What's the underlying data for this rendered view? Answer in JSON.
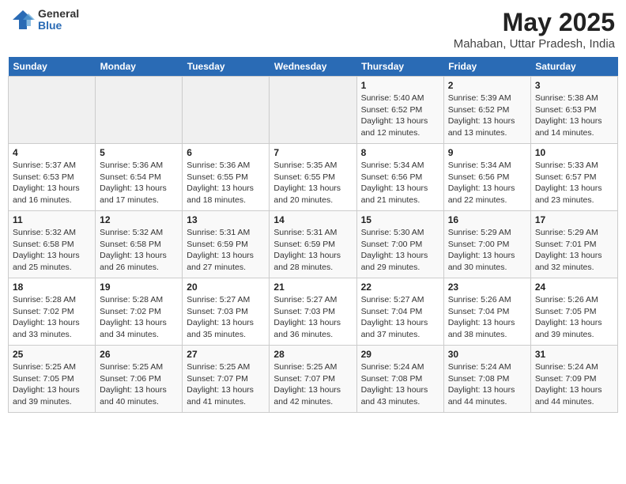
{
  "logo": {
    "general": "General",
    "blue": "Blue"
  },
  "title": "May 2025",
  "subtitle": "Mahaban, Uttar Pradesh, India",
  "days": [
    "Sunday",
    "Monday",
    "Tuesday",
    "Wednesday",
    "Thursday",
    "Friday",
    "Saturday"
  ],
  "weeks": [
    [
      {
        "date": "",
        "info": ""
      },
      {
        "date": "",
        "info": ""
      },
      {
        "date": "",
        "info": ""
      },
      {
        "date": "",
        "info": ""
      },
      {
        "date": "1",
        "info": "Sunrise: 5:40 AM\nSunset: 6:52 PM\nDaylight: 13 hours and 12 minutes."
      },
      {
        "date": "2",
        "info": "Sunrise: 5:39 AM\nSunset: 6:52 PM\nDaylight: 13 hours and 13 minutes."
      },
      {
        "date": "3",
        "info": "Sunrise: 5:38 AM\nSunset: 6:53 PM\nDaylight: 13 hours and 14 minutes."
      }
    ],
    [
      {
        "date": "4",
        "info": "Sunrise: 5:37 AM\nSunset: 6:53 PM\nDaylight: 13 hours and 16 minutes."
      },
      {
        "date": "5",
        "info": "Sunrise: 5:36 AM\nSunset: 6:54 PM\nDaylight: 13 hours and 17 minutes."
      },
      {
        "date": "6",
        "info": "Sunrise: 5:36 AM\nSunset: 6:55 PM\nDaylight: 13 hours and 18 minutes."
      },
      {
        "date": "7",
        "info": "Sunrise: 5:35 AM\nSunset: 6:55 PM\nDaylight: 13 hours and 20 minutes."
      },
      {
        "date": "8",
        "info": "Sunrise: 5:34 AM\nSunset: 6:56 PM\nDaylight: 13 hours and 21 minutes."
      },
      {
        "date": "9",
        "info": "Sunrise: 5:34 AM\nSunset: 6:56 PM\nDaylight: 13 hours and 22 minutes."
      },
      {
        "date": "10",
        "info": "Sunrise: 5:33 AM\nSunset: 6:57 PM\nDaylight: 13 hours and 23 minutes."
      }
    ],
    [
      {
        "date": "11",
        "info": "Sunrise: 5:32 AM\nSunset: 6:58 PM\nDaylight: 13 hours and 25 minutes."
      },
      {
        "date": "12",
        "info": "Sunrise: 5:32 AM\nSunset: 6:58 PM\nDaylight: 13 hours and 26 minutes."
      },
      {
        "date": "13",
        "info": "Sunrise: 5:31 AM\nSunset: 6:59 PM\nDaylight: 13 hours and 27 minutes."
      },
      {
        "date": "14",
        "info": "Sunrise: 5:31 AM\nSunset: 6:59 PM\nDaylight: 13 hours and 28 minutes."
      },
      {
        "date": "15",
        "info": "Sunrise: 5:30 AM\nSunset: 7:00 PM\nDaylight: 13 hours and 29 minutes."
      },
      {
        "date": "16",
        "info": "Sunrise: 5:29 AM\nSunset: 7:00 PM\nDaylight: 13 hours and 30 minutes."
      },
      {
        "date": "17",
        "info": "Sunrise: 5:29 AM\nSunset: 7:01 PM\nDaylight: 13 hours and 32 minutes."
      }
    ],
    [
      {
        "date": "18",
        "info": "Sunrise: 5:28 AM\nSunset: 7:02 PM\nDaylight: 13 hours and 33 minutes."
      },
      {
        "date": "19",
        "info": "Sunrise: 5:28 AM\nSunset: 7:02 PM\nDaylight: 13 hours and 34 minutes."
      },
      {
        "date": "20",
        "info": "Sunrise: 5:27 AM\nSunset: 7:03 PM\nDaylight: 13 hours and 35 minutes."
      },
      {
        "date": "21",
        "info": "Sunrise: 5:27 AM\nSunset: 7:03 PM\nDaylight: 13 hours and 36 minutes."
      },
      {
        "date": "22",
        "info": "Sunrise: 5:27 AM\nSunset: 7:04 PM\nDaylight: 13 hours and 37 minutes."
      },
      {
        "date": "23",
        "info": "Sunrise: 5:26 AM\nSunset: 7:04 PM\nDaylight: 13 hours and 38 minutes."
      },
      {
        "date": "24",
        "info": "Sunrise: 5:26 AM\nSunset: 7:05 PM\nDaylight: 13 hours and 39 minutes."
      }
    ],
    [
      {
        "date": "25",
        "info": "Sunrise: 5:25 AM\nSunset: 7:05 PM\nDaylight: 13 hours and 39 minutes."
      },
      {
        "date": "26",
        "info": "Sunrise: 5:25 AM\nSunset: 7:06 PM\nDaylight: 13 hours and 40 minutes."
      },
      {
        "date": "27",
        "info": "Sunrise: 5:25 AM\nSunset: 7:07 PM\nDaylight: 13 hours and 41 minutes."
      },
      {
        "date": "28",
        "info": "Sunrise: 5:25 AM\nSunset: 7:07 PM\nDaylight: 13 hours and 42 minutes."
      },
      {
        "date": "29",
        "info": "Sunrise: 5:24 AM\nSunset: 7:08 PM\nDaylight: 13 hours and 43 minutes."
      },
      {
        "date": "30",
        "info": "Sunrise: 5:24 AM\nSunset: 7:08 PM\nDaylight: 13 hours and 44 minutes."
      },
      {
        "date": "31",
        "info": "Sunrise: 5:24 AM\nSunset: 7:09 PM\nDaylight: 13 hours and 44 minutes."
      }
    ]
  ]
}
